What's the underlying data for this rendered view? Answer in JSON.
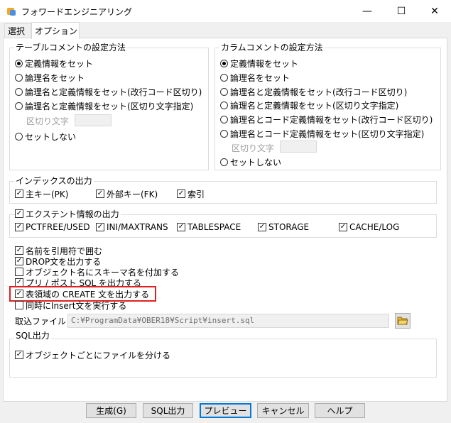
{
  "window": {
    "title": "フォワードエンジニアリング",
    "minimize": "—",
    "maximize": "☐",
    "close": "✕"
  },
  "tabs": [
    {
      "label": "選択"
    },
    {
      "label": "オプション"
    }
  ],
  "table_comment": {
    "title": "テーブルコメントの設定方法",
    "options": [
      {
        "label": "定義情報をセット",
        "selected": true
      },
      {
        "label": "論理名をセット",
        "selected": false
      },
      {
        "label": "論理名と定義情報をセット(改行コード区切り)",
        "selected": false
      },
      {
        "label": "論理名と定義情報をセット(区切り文字指定)",
        "selected": false
      },
      {
        "label": "セットしない",
        "selected": false
      }
    ],
    "delimiter_label": "区切り文字",
    "delimiter_value": ""
  },
  "column_comment": {
    "title": "カラムコメントの設定方法",
    "options": [
      {
        "label": "定義情報をセット",
        "selected": true
      },
      {
        "label": "論理名をセット",
        "selected": false
      },
      {
        "label": "論理名と定義情報をセット(改行コード区切り)",
        "selected": false
      },
      {
        "label": "論理名と定義情報をセット(区切り文字指定)",
        "selected": false
      },
      {
        "label": "論理名とコード定義情報をセット(改行コード区切り)",
        "selected": false
      },
      {
        "label": "論理名とコード定義情報をセット(区切り文字指定)",
        "selected": false
      },
      {
        "label": "セットしない",
        "selected": false
      }
    ],
    "delimiter_label": "区切り文字",
    "delimiter_value": ""
  },
  "index_output": {
    "title": "インデックスの出力",
    "options": [
      {
        "label": "主キー(PK)",
        "checked": true
      },
      {
        "label": "外部キー(FK)",
        "checked": true
      },
      {
        "label": "索引",
        "checked": true
      }
    ]
  },
  "extent_output": {
    "title": "エクステント情報の出力",
    "checked": true,
    "options": [
      {
        "label": "PCTFREE/USED",
        "checked": true
      },
      {
        "label": "INI/MAXTRANS",
        "checked": true
      },
      {
        "label": "TABLESPACE",
        "checked": true
      },
      {
        "label": "STORAGE",
        "checked": true
      },
      {
        "label": "CACHE/LOG",
        "checked": true
      }
    ]
  },
  "misc_options": [
    {
      "label": "名前を引用符で囲む",
      "checked": true
    },
    {
      "label": "DROP文を出力する",
      "checked": true
    },
    {
      "label": "オブジェクト名にスキーマ名を付加する",
      "checked": false
    },
    {
      "label": "プリ / ポスト SQL を出力する",
      "checked": true
    },
    {
      "label": "表領域の CREATE 文を出力する",
      "checked": true
    },
    {
      "label": "同時にInsert文を実行する",
      "checked": false
    }
  ],
  "import_file": {
    "label": "取込ファイル",
    "value": "C:¥ProgramData¥OBER18¥Script¥insert.sql"
  },
  "sql_output": {
    "title": "SQL出力",
    "option": {
      "label": "オブジェクトごとにファイルを分ける",
      "checked": true
    }
  },
  "buttons": {
    "generate": "生成(G)",
    "sql_output": "SQL出力",
    "preview": "プレビュー",
    "cancel": "キャンセル",
    "help": "ヘルプ"
  },
  "colors": {
    "highlight": "#e02020",
    "accent": "#0078d7"
  }
}
